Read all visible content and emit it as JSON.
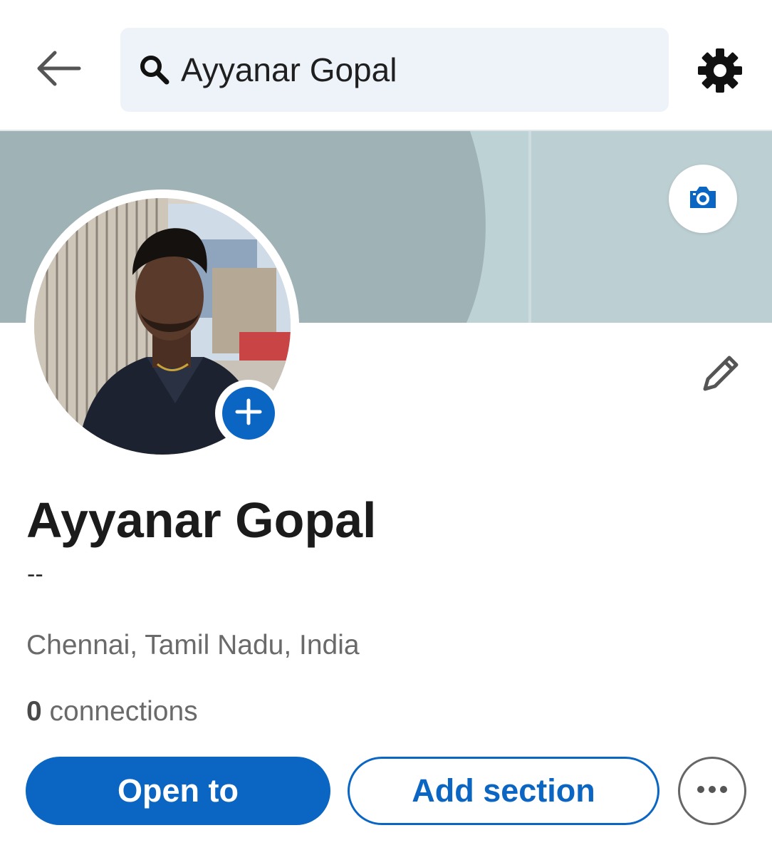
{
  "search": {
    "query": "Ayyanar Gopal"
  },
  "profile": {
    "name": "Ayyanar Gopal",
    "headline": "--",
    "location": "Chennai, Tamil Nadu, India",
    "connections_count": "0",
    "connections_label": "connections"
  },
  "actions": {
    "open_to_label": "Open to",
    "add_section_label": "Add section"
  },
  "icons": {
    "back": "arrow-left-icon",
    "search": "search-icon",
    "settings": "gear-icon",
    "camera": "camera-icon",
    "add_photo": "plus-icon",
    "edit": "pencil-icon",
    "more": "more-dots-icon"
  },
  "colors": {
    "accent": "#0a66c2",
    "search_bg": "#edf3f8",
    "banner_dark": "#9fb3b6",
    "banner_light": "#bdd2d4",
    "text_primary": "#1b1b1b",
    "text_secondary": "#6a6a6a"
  }
}
